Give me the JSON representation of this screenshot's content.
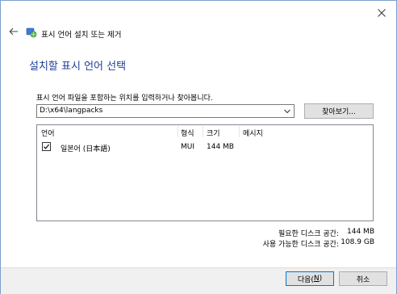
{
  "header": {
    "nav_title": "표시 언어 설치 또는 제거"
  },
  "page": {
    "heading": "설치할 표시 언어 선택",
    "instruction": "표시 언어 파일을 포함하는 위치를 입력하거나 찾아봅니다."
  },
  "path": {
    "value": "D:\\x64\\langpacks",
    "browse_label": "찾아보기..."
  },
  "list": {
    "columns": [
      "언어",
      "형식",
      "크기",
      "메시지"
    ],
    "rows": [
      {
        "checked": true,
        "language": "일본어 (日本語)",
        "format": "MUI",
        "size": "144 MB",
        "message": ""
      }
    ]
  },
  "space": {
    "required_label": "필요한 디스크 공간:",
    "required_value": "144 MB",
    "available_label": "사용 가능한 디스크 공간:",
    "available_value": "108.9 GB"
  },
  "footer": {
    "next_label": "다음(",
    "next_key": "N",
    "next_tail": ")",
    "cancel_label": "취소"
  },
  "icons": {
    "close": "close-icon",
    "back": "back-arrow-icon",
    "app": "language-globe-icon",
    "dropdown": "chevron-down-icon",
    "check": "checkmark-icon"
  }
}
